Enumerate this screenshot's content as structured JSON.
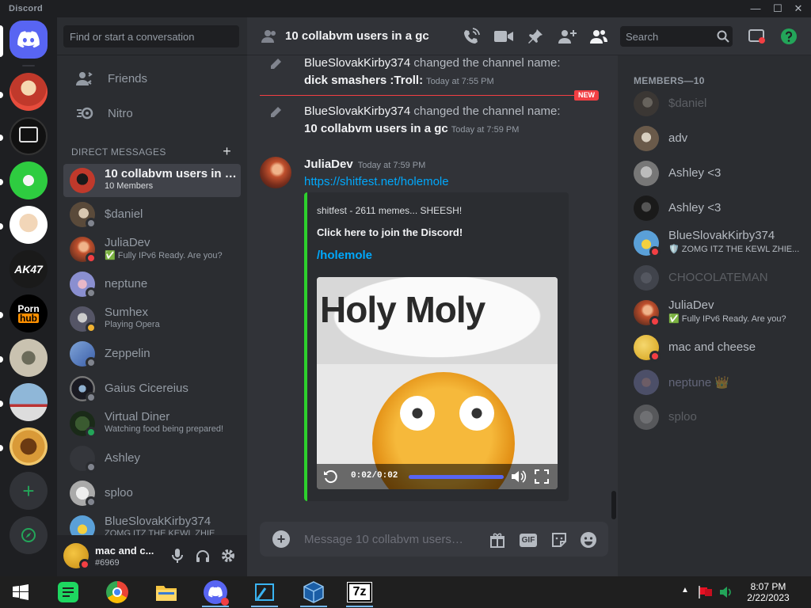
{
  "window": {
    "title": "Discord"
  },
  "sidebar": {
    "search_placeholder": "Find or start a conversation"
  },
  "nav": {
    "friends": "Friends",
    "nitro": "Nitro"
  },
  "dm_section": {
    "header": "DIRECT MESSAGES"
  },
  "dms": [
    {
      "name": "10 collabvm users in a...",
      "sub": "10 Members",
      "status": "none",
      "active": true
    },
    {
      "name": "$daniel",
      "sub": "",
      "status": "offline"
    },
    {
      "name": "JuliaDev",
      "sub": "✅ Fully IPv6 Ready. Are you?",
      "status": "dnd"
    },
    {
      "name": "neptune",
      "sub": "",
      "status": "offline"
    },
    {
      "name": "Sumhex",
      "sub": "Playing Opera",
      "status": "idle"
    },
    {
      "name": "Zeppelin",
      "sub": "",
      "status": "offline"
    },
    {
      "name": "Gaius Cicereius",
      "sub": "",
      "status": "offline"
    },
    {
      "name": "Virtual Diner",
      "sub": "Watching food being prepared!",
      "status": "online"
    },
    {
      "name": "Ashley",
      "sub": "",
      "status": "offline"
    },
    {
      "name": "sploo",
      "sub": "",
      "status": "offline"
    },
    {
      "name": "BlueSlovakKirby374",
      "sub": "ZOMG ITZ THE KEWL ZHIE",
      "status": "dnd"
    }
  ],
  "user": {
    "name": "mac and c...",
    "tag": "#6969"
  },
  "chat": {
    "title": "10 collabvm users in a gc",
    "search_placeholder": "Search",
    "messages": [
      {
        "author": "BlueSlovakKirby374",
        "action": " changed the channel name:",
        "new_name": "dick smashers :Troll:",
        "time": "Today at 7:55 PM"
      },
      {
        "author": "BlueSlovakKirby374",
        "action": " changed the channel name:",
        "new_name": "10 collabvm users in a gc",
        "time": "Today at 7:59 PM"
      }
    ],
    "new_badge": "NEW",
    "post": {
      "author": "JuliaDev",
      "time": "Today at 7:59 PM",
      "link": "https://shitfest.net/holemole",
      "embed": {
        "provider": "shitfest - 2611 memes... SHEESH!",
        "title": "Click here to join the Discord!",
        "link": "/holemole",
        "video_caption": "Holy Moly",
        "video_time": "0:02/0:02",
        "progress": 1.0
      }
    },
    "composer_placeholder": "Message 10 collabvm users i...",
    "gif_label": "GIF"
  },
  "members": {
    "header": "MEMBERS—10",
    "list": [
      {
        "name": "$daniel",
        "sub": "",
        "status": "offline",
        "av": "#6a5d4d"
      },
      {
        "name": "adv",
        "sub": "",
        "status": "offline",
        "av": "#8a7c6c"
      },
      {
        "name": "Ashley <3",
        "sub": "",
        "status": "offline",
        "av": "#7b7b7b"
      },
      {
        "name": "Ashley <3",
        "sub": "",
        "status": "offline",
        "av": "#2a2a2a"
      },
      {
        "name": "BlueSlovakKirby374",
        "sub": "🛡️ ZOMG ITZ THE KEWL ZHIE...",
        "status": "dnd",
        "av": "#5aa0d8"
      },
      {
        "name": "CHOCOLATEMAN",
        "sub": "",
        "status": "offline",
        "av": "#6a7080"
      },
      {
        "name": "JuliaDev",
        "sub": "✅ Fully IPv6 Ready. Are you?",
        "status": "dnd",
        "av": "#b9502f"
      },
      {
        "name": "mac and cheese",
        "sub": "",
        "status": "dnd",
        "av": "#e8b83a"
      },
      {
        "name": "neptune 👑",
        "sub": "",
        "status": "offline",
        "av": "#8a8fd0"
      },
      {
        "name": "sploo",
        "sub": "",
        "status": "offline",
        "av": "#bdbdbd"
      }
    ]
  },
  "taskbar": {
    "time": "8:07 PM",
    "date": "2/22/2023"
  },
  "guild_servers": [
    {
      "icon": "guild-red-character-icon",
      "color": "#c0392b"
    },
    {
      "icon": "guild-box-logo-icon",
      "color": "#111111"
    },
    {
      "icon": "guild-trollface-icon",
      "color": "#2ecc40"
    },
    {
      "icon": "guild-peter-griffin-icon",
      "color": "#f0f0f0"
    },
    {
      "icon": "guild-ak47-icon",
      "color": "#222222"
    },
    {
      "icon": "guild-ph-logo-icon",
      "color": "#000000"
    },
    {
      "icon": "guild-photo-icon",
      "color": "#a8a090"
    },
    {
      "icon": "guild-building-icon",
      "color": "#7aa7c7"
    },
    {
      "icon": "guild-burger-icon",
      "color": "#c8842a"
    }
  ]
}
